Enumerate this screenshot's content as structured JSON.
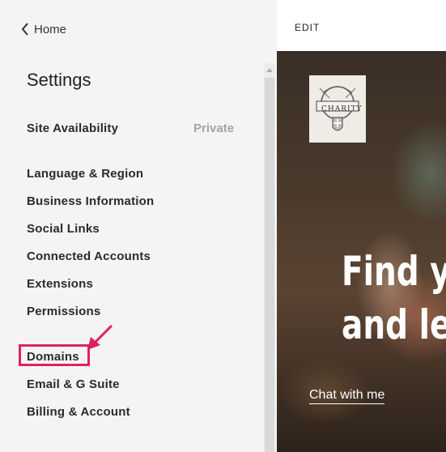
{
  "nav": {
    "back_label": "Home"
  },
  "sidebar": {
    "title": "Settings",
    "site_availability": {
      "label": "Site Availability",
      "value": "Private"
    },
    "items": [
      {
        "label": "Language & Region"
      },
      {
        "label": "Business Information"
      },
      {
        "label": "Social Links"
      },
      {
        "label": "Connected Accounts"
      },
      {
        "label": "Extensions"
      },
      {
        "label": "Permissions"
      },
      {
        "label": "Domains"
      },
      {
        "label": "Email & G Suite"
      },
      {
        "label": "Billing & Account"
      }
    ],
    "highlighted_item": "Domains",
    "highlight_color": "#e0215f"
  },
  "preview": {
    "edit_label": "EDIT",
    "logo_text": "CHARITY",
    "hero_line_1": "Find y",
    "hero_line_2": "and le",
    "link_label": "Chat with me"
  }
}
